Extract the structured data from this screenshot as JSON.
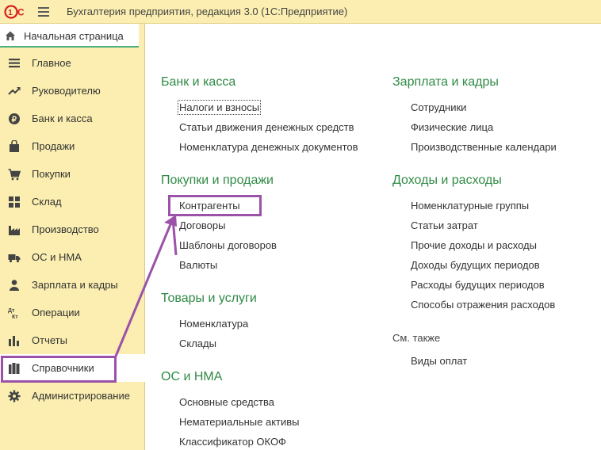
{
  "app": {
    "title": "Бухгалтерия предприятия, редакция 3.0   (1С:Предприятие)",
    "start_page_label": "Начальная страница"
  },
  "sidebar": {
    "items": [
      {
        "label": "Главное",
        "icon": "list-icon"
      },
      {
        "label": "Руководителю",
        "icon": "trend-icon"
      },
      {
        "label": "Банк и касса",
        "icon": "ruble-icon"
      },
      {
        "label": "Продажи",
        "icon": "shopping-bag-icon"
      },
      {
        "label": "Покупки",
        "icon": "cart-icon"
      },
      {
        "label": "Склад",
        "icon": "warehouse-grid-icon"
      },
      {
        "label": "Производство",
        "icon": "factory-icon"
      },
      {
        "label": "ОС и НМА",
        "icon": "truck-icon"
      },
      {
        "label": "Зарплата и кадры",
        "icon": "person-icon"
      },
      {
        "label": "Операции",
        "icon": "dt-kt-icon",
        "icon_text": "Дт\nКт"
      },
      {
        "label": "Отчеты",
        "icon": "bar-chart-icon"
      },
      {
        "label": "Справочники",
        "icon": "books-icon",
        "active": true
      },
      {
        "label": "Администрирование",
        "icon": "gear-icon"
      }
    ]
  },
  "sections": {
    "bank": {
      "title": "Банк и касса",
      "links": [
        "Налоги и взносы",
        "Статьи движения денежных средств",
        "Номенклатура денежных документов"
      ]
    },
    "purchases_sales": {
      "title": "Покупки и продажи",
      "links": [
        "Контрагенты",
        "Договоры",
        "Шаблоны договоров",
        "Валюты"
      ]
    },
    "goods": {
      "title": "Товары и услуги",
      "links": [
        "Номенклатура",
        "Склады"
      ]
    },
    "os_nma": {
      "title": "ОС и НМА",
      "links": [
        "Основные средства",
        "Нематериальные активы",
        "Классификатор ОКОФ"
      ]
    },
    "salary": {
      "title": "Зарплата и кадры",
      "links": [
        "Сотрудники",
        "Физические лица",
        "Производственные календари"
      ]
    },
    "income_expense": {
      "title": "Доходы и расходы",
      "links": [
        "Номенклатурные группы",
        "Статьи затрат",
        "Прочие доходы и расходы",
        "Доходы будущих периодов",
        "Расходы будущих периодов",
        "Способы отражения расходов"
      ]
    },
    "see_also": {
      "title": "См. также",
      "links": [
        "Виды оплат"
      ]
    }
  },
  "colors": {
    "panel_bg": "#fbeeb0",
    "section_title": "#2f8a45",
    "annotation": "#9b52a8",
    "logo_red": "#d6201f"
  }
}
